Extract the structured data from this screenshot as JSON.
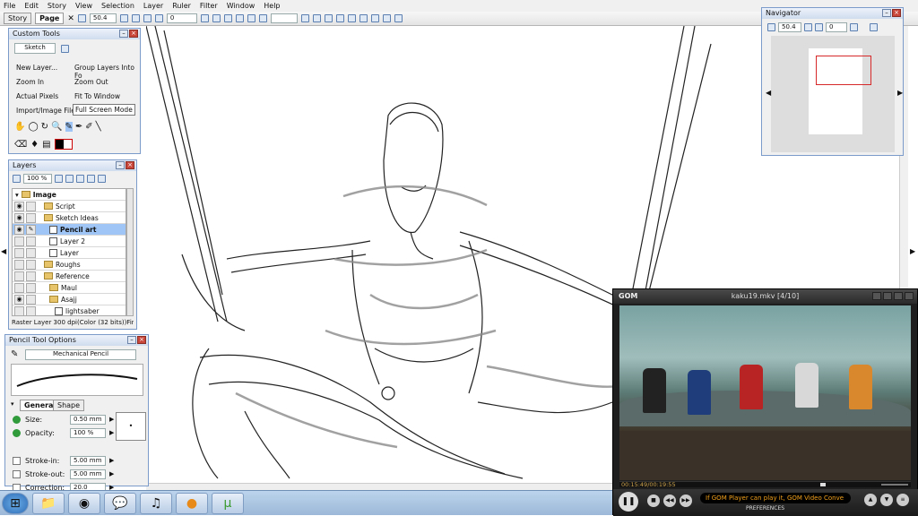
{
  "menu": [
    "File",
    "Edit",
    "Story",
    "View",
    "Selection",
    "Layer",
    "Ruler",
    "Filter",
    "Window",
    "Help"
  ],
  "toolbar": {
    "tabs": [
      "Story",
      "Page"
    ],
    "zoom": "50.4",
    "rotate": "0"
  },
  "custom_tools": {
    "title": "Custom Tools",
    "preset": "Sketch",
    "commands": [
      [
        "New Layer...",
        "Group Layers Into Fo"
      ],
      [
        "Zoom In",
        "Zoom Out"
      ],
      [
        "Actual Pixels",
        "Fit To Window"
      ],
      [
        "Import/Image File...",
        "Full Screen Mode"
      ]
    ]
  },
  "layers": {
    "title": "Layers",
    "opacity": "100 %",
    "root": "Image",
    "rows": [
      {
        "label": "Script",
        "kind": "folder",
        "indent": 1
      },
      {
        "label": "Sketch Ideas",
        "kind": "folder",
        "indent": 1
      },
      {
        "label": "Pencil art",
        "kind": "layer",
        "indent": 2,
        "selected": true
      },
      {
        "label": "Layer 2",
        "kind": "layer",
        "indent": 2
      },
      {
        "label": "Layer",
        "kind": "layer",
        "indent": 2
      },
      {
        "label": "Roughs",
        "kind": "folder",
        "indent": 1
      },
      {
        "label": "Reference",
        "kind": "folder",
        "indent": 1
      },
      {
        "label": "Maul",
        "kind": "folder",
        "indent": 2
      },
      {
        "label": "Asajj",
        "kind": "folder",
        "indent": 2
      },
      {
        "label": "lightsaber",
        "kind": "layer",
        "indent": 3
      }
    ],
    "status": "Raster Layer 300 dpi(Color (32 bits))Fini..."
  },
  "pencil_options": {
    "title": "Pencil Tool Options",
    "brush": "Mechanical Pencil",
    "tabs": [
      "General",
      "Shape"
    ],
    "settings": [
      {
        "label": "Size:",
        "value": "0.50 mm"
      },
      {
        "label": "Opacity:",
        "value": "100 %"
      },
      {
        "label": "Stroke-in:",
        "value": "5.00 mm"
      },
      {
        "label": "Stroke-out:",
        "value": "5.00 mm"
      },
      {
        "label": "Correction:",
        "value": "20.0"
      }
    ]
  },
  "navigator": {
    "title": "Navigator",
    "zoom": "50.4",
    "rotate": "0"
  },
  "gom": {
    "logo": "GOM",
    "title": "kaku19.mkv [4/10]",
    "time": "00:15:49/00:19:55",
    "ticker": "If GOM Player can play it, GOM Video Conve",
    "preferences": "PREFERENCES"
  },
  "colors": {
    "accent": "#7b9ccb",
    "selection": "#9ec5f5",
    "nav_frame": "#d62828"
  }
}
